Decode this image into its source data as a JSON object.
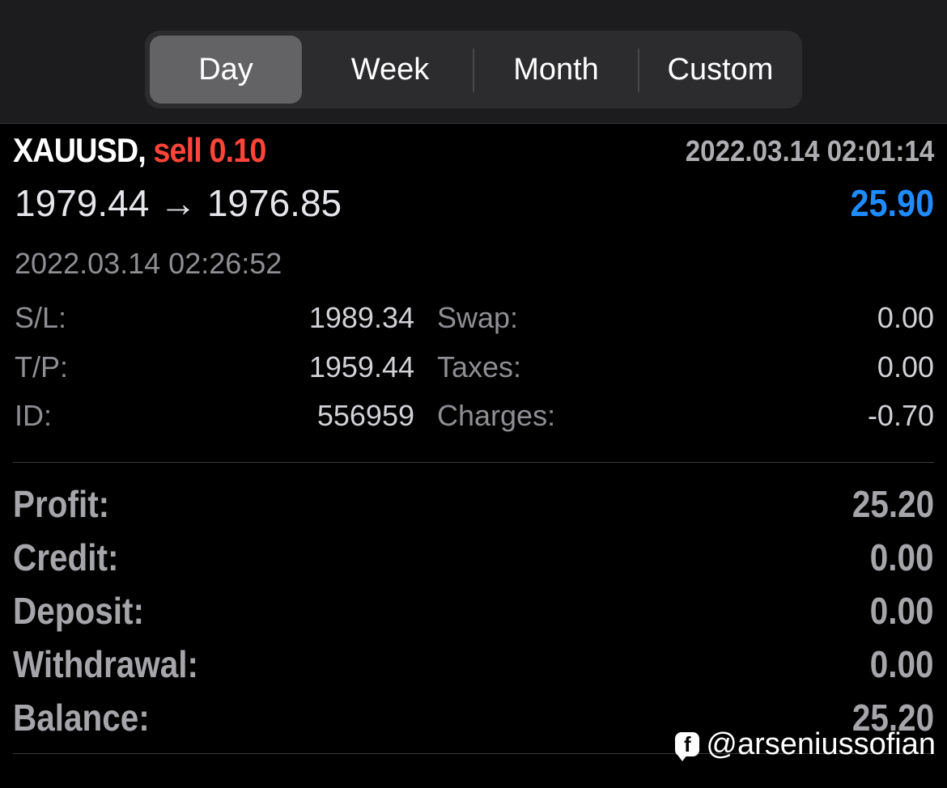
{
  "tabs": [
    {
      "label": "Day",
      "active": true
    },
    {
      "label": "Week",
      "active": false
    },
    {
      "label": "Month",
      "active": false
    },
    {
      "label": "Custom",
      "active": false
    }
  ],
  "trade": {
    "symbol": "XAUUSD,",
    "side_volume": "sell 0.10",
    "open_time": "2022.03.14 02:01:14",
    "prices": "1979.44 → 1976.85",
    "profit": "25.90",
    "close_time": "2022.03.14 02:26:52",
    "details": {
      "sl_label": "S/L:",
      "sl_value": "1989.34",
      "tp_label": "T/P:",
      "tp_value": "1959.44",
      "id_label": "ID:",
      "id_value": "556959",
      "swap_label": "Swap:",
      "swap_value": "0.00",
      "taxes_label": "Taxes:",
      "taxes_value": "0.00",
      "charges_label": "Charges:",
      "charges_value": "-0.70"
    }
  },
  "summary": [
    {
      "label": "Profit:",
      "value": "25.20"
    },
    {
      "label": "Credit:",
      "value": "0.00"
    },
    {
      "label": "Deposit:",
      "value": "0.00"
    },
    {
      "label": "Withdrawal:",
      "value": "0.00"
    },
    {
      "label": "Balance:",
      "value": "25.20"
    }
  ],
  "watermark": {
    "icon": "facebook-icon",
    "glyph": "f",
    "handle": "@arseniussofian"
  },
  "colors": {
    "sell": "#ff453a",
    "profit": "#1e8cff",
    "background": "#000000",
    "segment_active": "#636366"
  }
}
